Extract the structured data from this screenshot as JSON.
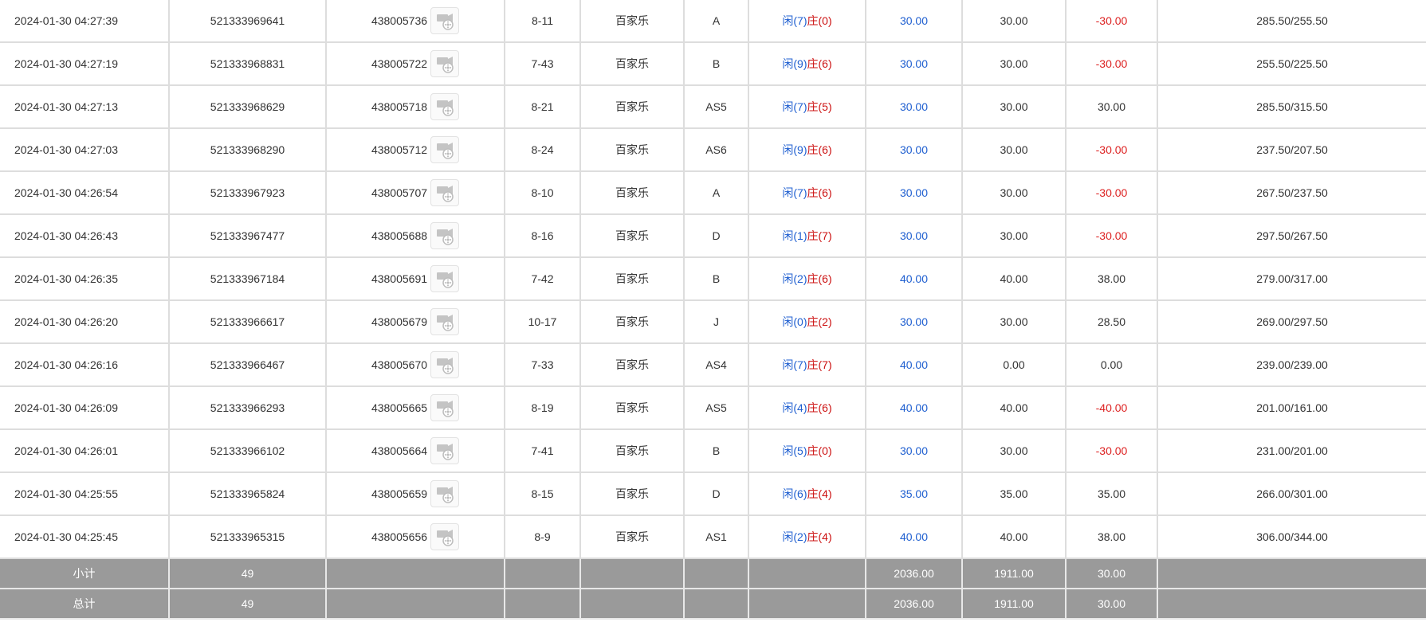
{
  "rows": [
    {
      "time": "2024-01-30 04:27:39",
      "bet_no": "521333969641",
      "round": "438005736",
      "shoe": "8-11",
      "game": "百家乐",
      "table": "A",
      "p_label": "闲",
      "p": "(7)",
      "b_label": "庄",
      "b": "(0)",
      "bet": "30.00",
      "valid": "30.00",
      "win": "-30.00",
      "balance": "285.50/255.50"
    },
    {
      "time": "2024-01-30 04:27:19",
      "bet_no": "521333968831",
      "round": "438005722",
      "shoe": "7-43",
      "game": "百家乐",
      "table": "B",
      "p_label": "闲",
      "p": "(9)",
      "b_label": "庄",
      "b": "(6)",
      "bet": "30.00",
      "valid": "30.00",
      "win": "-30.00",
      "balance": "255.50/225.50"
    },
    {
      "time": "2024-01-30 04:27:13",
      "bet_no": "521333968629",
      "round": "438005718",
      "shoe": "8-21",
      "game": "百家乐",
      "table": "AS5",
      "p_label": "闲",
      "p": "(7)",
      "b_label": "庄",
      "b": "(5)",
      "bet": "30.00",
      "valid": "30.00",
      "win": "30.00",
      "balance": "285.50/315.50"
    },
    {
      "time": "2024-01-30 04:27:03",
      "bet_no": "521333968290",
      "round": "438005712",
      "shoe": "8-24",
      "game": "百家乐",
      "table": "AS6",
      "p_label": "闲",
      "p": "(9)",
      "b_label": "庄",
      "b": "(6)",
      "bet": "30.00",
      "valid": "30.00",
      "win": "-30.00",
      "balance": "237.50/207.50"
    },
    {
      "time": "2024-01-30 04:26:54",
      "bet_no": "521333967923",
      "round": "438005707",
      "shoe": "8-10",
      "game": "百家乐",
      "table": "A",
      "p_label": "闲",
      "p": "(7)",
      "b_label": "庄",
      "b": "(6)",
      "bet": "30.00",
      "valid": "30.00",
      "win": "-30.00",
      "balance": "267.50/237.50"
    },
    {
      "time": "2024-01-30 04:26:43",
      "bet_no": "521333967477",
      "round": "438005688",
      "shoe": "8-16",
      "game": "百家乐",
      "table": "D",
      "p_label": "闲",
      "p": "(1)",
      "b_label": "庄",
      "b": "(7)",
      "bet": "30.00",
      "valid": "30.00",
      "win": "-30.00",
      "balance": "297.50/267.50"
    },
    {
      "time": "2024-01-30 04:26:35",
      "bet_no": "521333967184",
      "round": "438005691",
      "shoe": "7-42",
      "game": "百家乐",
      "table": "B",
      "p_label": "闲",
      "p": "(2)",
      "b_label": "庄",
      "b": "(6)",
      "bet": "40.00",
      "valid": "40.00",
      "win": "38.00",
      "balance": "279.00/317.00"
    },
    {
      "time": "2024-01-30 04:26:20",
      "bet_no": "521333966617",
      "round": "438005679",
      "shoe": "10-17",
      "game": "百家乐",
      "table": "J",
      "p_label": "闲",
      "p": "(0)",
      "b_label": "庄",
      "b": "(2)",
      "bet": "30.00",
      "valid": "30.00",
      "win": "28.50",
      "balance": "269.00/297.50"
    },
    {
      "time": "2024-01-30 04:26:16",
      "bet_no": "521333966467",
      "round": "438005670",
      "shoe": "7-33",
      "game": "百家乐",
      "table": "AS4",
      "p_label": "闲",
      "p": "(7)",
      "b_label": "庄",
      "b": "(7)",
      "bet": "40.00",
      "valid": "0.00",
      "win": "0.00",
      "balance": "239.00/239.00"
    },
    {
      "time": "2024-01-30 04:26:09",
      "bet_no": "521333966293",
      "round": "438005665",
      "shoe": "8-19",
      "game": "百家乐",
      "table": "AS5",
      "p_label": "闲",
      "p": "(4)",
      "b_label": "庄",
      "b": "(6)",
      "bet": "40.00",
      "valid": "40.00",
      "win": "-40.00",
      "balance": "201.00/161.00"
    },
    {
      "time": "2024-01-30 04:26:01",
      "bet_no": "521333966102",
      "round": "438005664",
      "shoe": "7-41",
      "game": "百家乐",
      "table": "B",
      "p_label": "闲",
      "p": "(5)",
      "b_label": "庄",
      "b": "(0)",
      "bet": "30.00",
      "valid": "30.00",
      "win": "-30.00",
      "balance": "231.00/201.00"
    },
    {
      "time": "2024-01-30 04:25:55",
      "bet_no": "521333965824",
      "round": "438005659",
      "shoe": "8-15",
      "game": "百家乐",
      "table": "D",
      "p_label": "闲",
      "p": "(6)",
      "b_label": "庄",
      "b": "(4)",
      "bet": "35.00",
      "valid": "35.00",
      "win": "35.00",
      "balance": "266.00/301.00"
    },
    {
      "time": "2024-01-30 04:25:45",
      "bet_no": "521333965315",
      "round": "438005656",
      "shoe": "8-9",
      "game": "百家乐",
      "table": "AS1",
      "p_label": "闲",
      "p": "(2)",
      "b_label": "庄",
      "b": "(4)",
      "bet": "40.00",
      "valid": "40.00",
      "win": "38.00",
      "balance": "306.00/344.00"
    }
  ],
  "subtotal": {
    "label": "小计",
    "count": "49",
    "bet": "2036.00",
    "valid": "1911.00",
    "win": "30.00"
  },
  "total": {
    "label": "总计",
    "count": "49",
    "bet": "2036.00",
    "valid": "1911.00",
    "win": "30.00"
  },
  "icons": {
    "replay": "video-replay-icon"
  },
  "colors": {
    "player": "#1f5fd0",
    "banker": "#cc1111",
    "loss": "#dd2222",
    "footer_bg": "#9a9a9a"
  }
}
